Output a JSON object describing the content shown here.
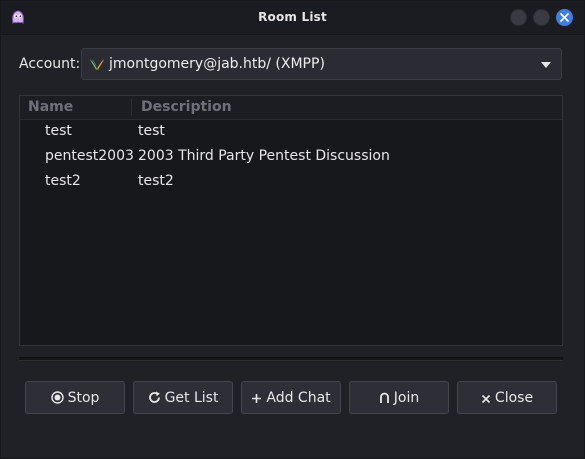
{
  "window": {
    "title": "Room List"
  },
  "account": {
    "label": "Account:",
    "selected": "jmontgomery@jab.htb/ (XMPP)"
  },
  "room_list": {
    "columns": [
      "Name",
      "Description"
    ],
    "rows": [
      {
        "name": "test",
        "description": "test"
      },
      {
        "name": "pentest2003",
        "description": "2003 Third Party Pentest Discussion"
      },
      {
        "name": "test2",
        "description": "test2"
      }
    ]
  },
  "buttons": {
    "stop": "Stop",
    "get_list": "Get List",
    "add_chat": "Add Chat",
    "join": "Join",
    "close": "Close"
  },
  "icons": {
    "app": "pidgin-icon",
    "account": "xmpp-icon",
    "dropdown": "chevron-down-icon",
    "stop": "stop-icon",
    "get_list": "refresh-icon",
    "add_chat": "plus-icon",
    "join": "join-icon",
    "close": "close-icon"
  },
  "colors": {
    "accent": "#3f7fde",
    "background": "#202127"
  }
}
